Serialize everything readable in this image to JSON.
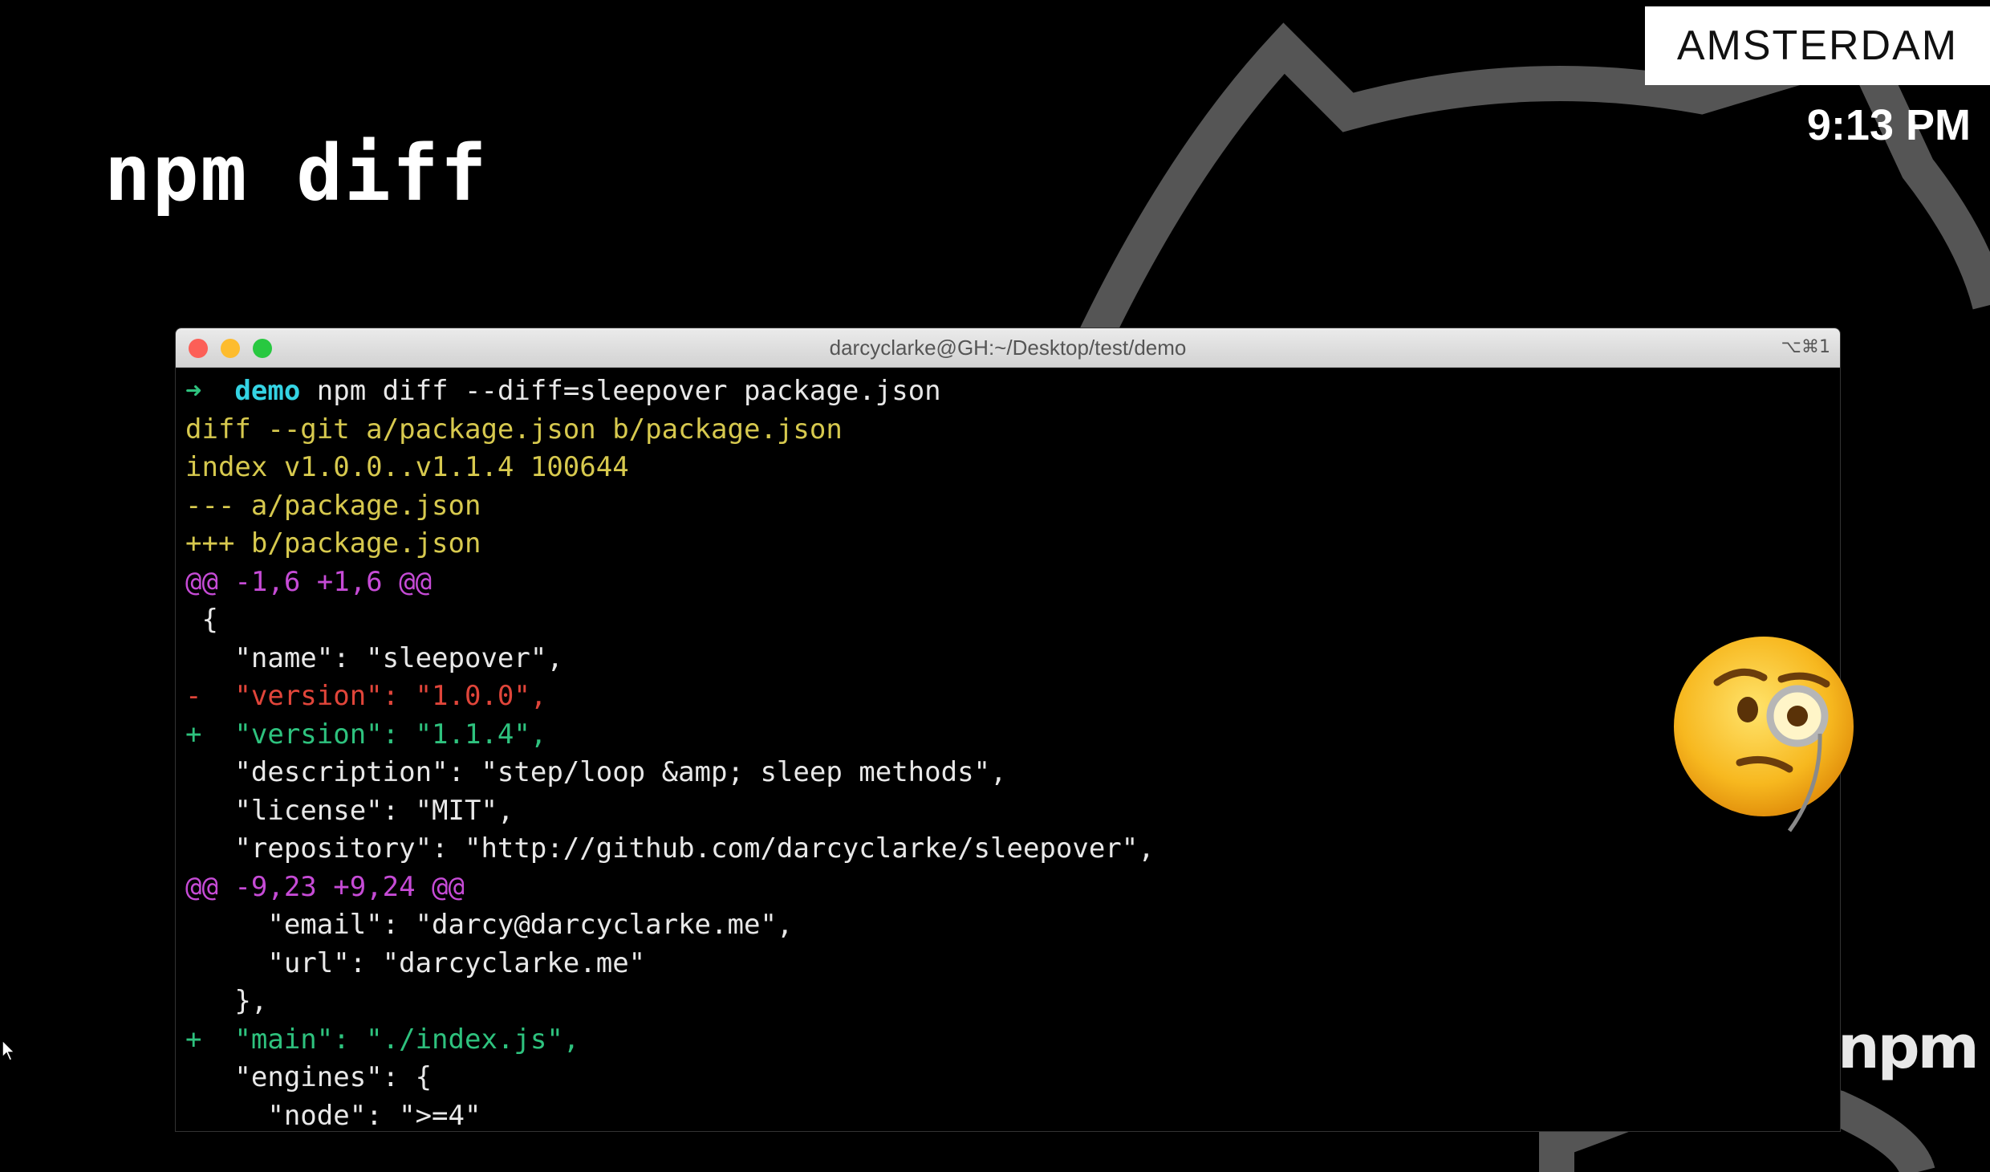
{
  "slide": {
    "title": "npm diff"
  },
  "overlay": {
    "city": "AMSTERDAM",
    "time": "9:13 PM",
    "brand": "npm"
  },
  "terminal": {
    "title": "darcyclarke@GH:~/Desktop/test/demo",
    "shortcut": "⌥⌘1",
    "lines": [
      {
        "segs": [
          {
            "t": "➜  ",
            "c": "#2ec27e"
          },
          {
            "t": "demo",
            "c": "#34d3e3",
            "b": true
          },
          {
            "t": " npm diff --diff=sleepover package.json",
            "c": "#e8e8e8"
          }
        ]
      },
      {
        "segs": [
          {
            "t": "diff --git a/package.json b/package.json",
            "c": "#d7c94e"
          }
        ]
      },
      {
        "segs": [
          {
            "t": "index v1.0.0..v1.1.4 100644",
            "c": "#d7c94e"
          }
        ]
      },
      {
        "segs": [
          {
            "t": "--- a/package.json",
            "c": "#d7c94e"
          }
        ]
      },
      {
        "segs": [
          {
            "t": "+++ b/package.json",
            "c": "#d7c94e"
          }
        ]
      },
      {
        "segs": [
          {
            "t": "@@ -1,6 +1,6 @@",
            "c": "#c64bd6"
          }
        ]
      },
      {
        "segs": [
          {
            "t": " {",
            "c": "#e8e8e8"
          }
        ]
      },
      {
        "segs": [
          {
            "t": "   \"name\": \"sleepover\",",
            "c": "#e8e8e8"
          }
        ]
      },
      {
        "segs": [
          {
            "t": "-  \"version\": \"1.0.0\",",
            "c": "#e0453a"
          }
        ]
      },
      {
        "segs": [
          {
            "t": "+  \"version\": \"1.1.4\",",
            "c": "#2ec27e"
          }
        ]
      },
      {
        "segs": [
          {
            "t": "   \"description\": \"step/loop &amp; sleep methods\",",
            "c": "#e8e8e8"
          }
        ]
      },
      {
        "segs": [
          {
            "t": "   \"license\": \"MIT\",",
            "c": "#e8e8e8"
          }
        ]
      },
      {
        "segs": [
          {
            "t": "   \"repository\": \"http://github.com/darcyclarke/sleepover\",",
            "c": "#e8e8e8"
          }
        ]
      },
      {
        "segs": [
          {
            "t": "@@ -9,23 +9,24 @@",
            "c": "#c64bd6"
          }
        ]
      },
      {
        "segs": [
          {
            "t": "     \"email\": \"darcy@darcyclarke.me\",",
            "c": "#e8e8e8"
          }
        ]
      },
      {
        "segs": [
          {
            "t": "     \"url\": \"darcyclarke.me\"",
            "c": "#e8e8e8"
          }
        ]
      },
      {
        "segs": [
          {
            "t": "   },",
            "c": "#e8e8e8"
          }
        ]
      },
      {
        "segs": [
          {
            "t": "+  \"main\": \"./index.js\",",
            "c": "#2ec27e"
          }
        ]
      },
      {
        "segs": [
          {
            "t": "   \"engines\": {",
            "c": "#e8e8e8"
          }
        ]
      },
      {
        "segs": [
          {
            "t": "     \"node\": \">=4\"",
            "c": "#e8e8e8"
          }
        ]
      }
    ]
  },
  "icons": {
    "emoji": "face-with-monocle-icon",
    "cursor": "mouse-pointer-icon",
    "background": "octocat-outline-icon"
  }
}
